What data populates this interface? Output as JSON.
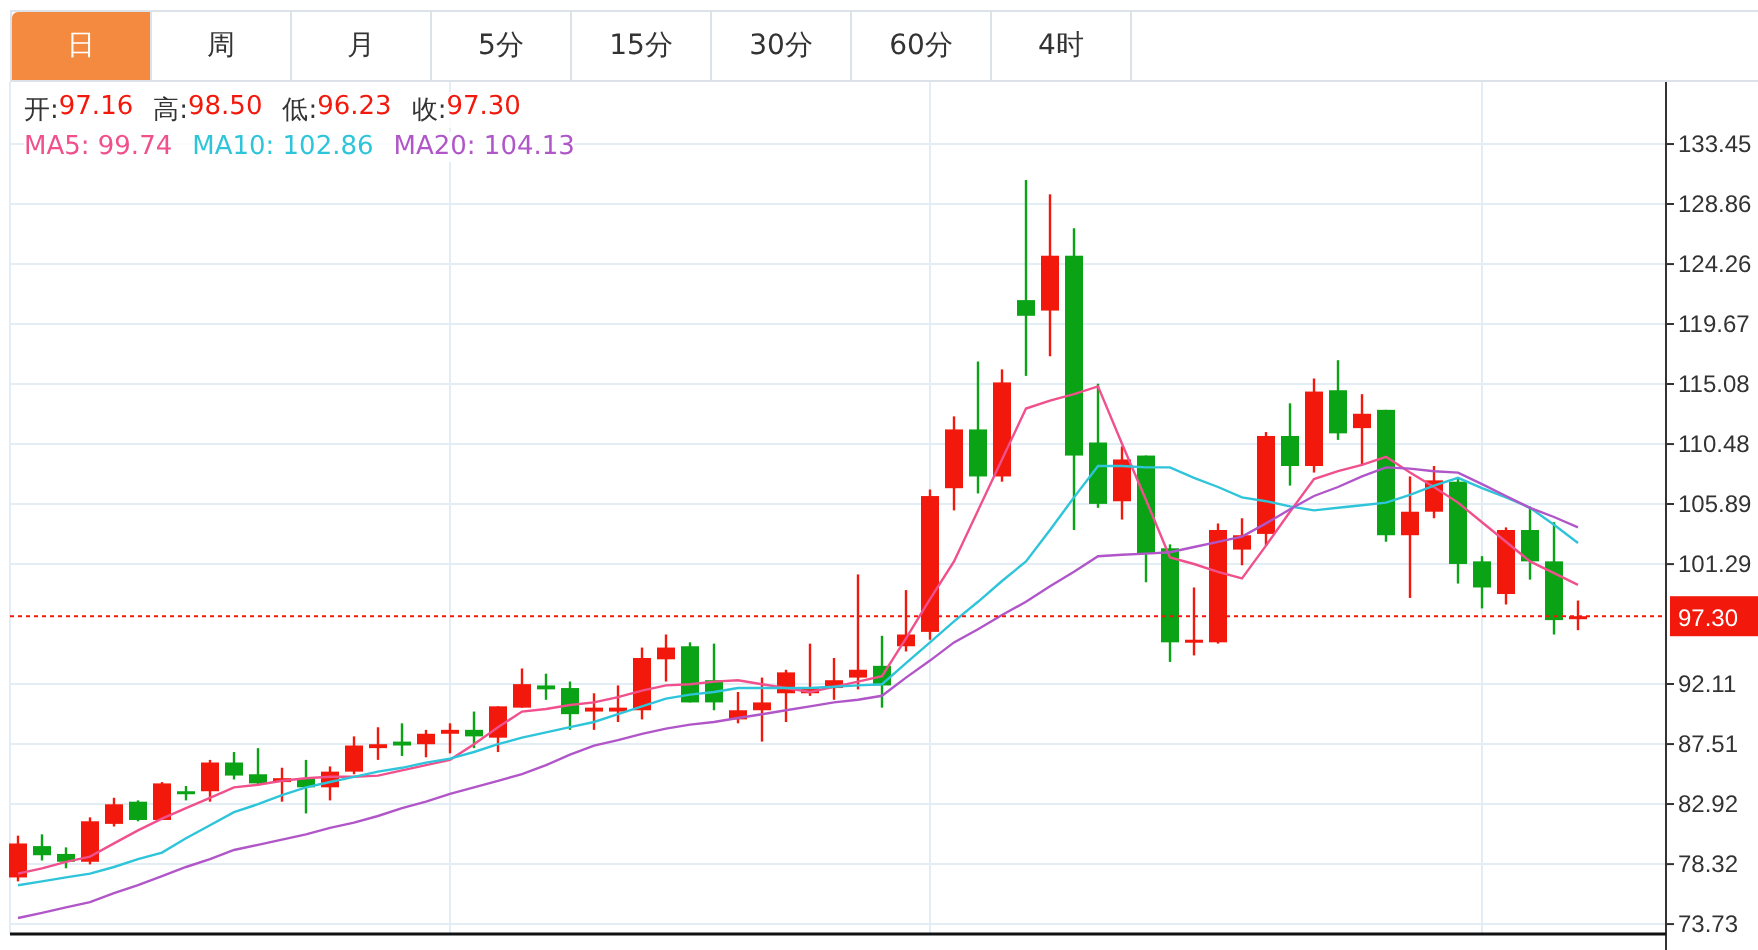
{
  "tabs": [
    {
      "label": "日",
      "selected": true
    },
    {
      "label": "周",
      "selected": false
    },
    {
      "label": "月",
      "selected": false
    },
    {
      "label": "5分",
      "selected": false
    },
    {
      "label": "15分",
      "selected": false
    },
    {
      "label": "30分",
      "selected": false
    },
    {
      "label": "60分",
      "selected": false
    },
    {
      "label": "4时",
      "selected": false
    }
  ],
  "ohlc_info": [
    {
      "label": "开:",
      "value": "97.16"
    },
    {
      "label": "高:",
      "value": "98.50"
    },
    {
      "label": "低:",
      "value": "96.23"
    },
    {
      "label": "收:",
      "value": "97.30"
    }
  ],
  "chart_data": {
    "type": "candlestick",
    "grid": true,
    "ylim": [
      72.97,
      138.2
    ],
    "yticks": [
      133.45,
      128.86,
      124.26,
      119.67,
      115.08,
      110.48,
      105.89,
      101.29,
      92.11,
      87.51,
      82.92,
      78.32,
      73.73
    ],
    "ohlc": [
      [
        77.3,
        80.5,
        77.0,
        79.9
      ],
      [
        79.7,
        80.6,
        78.6,
        79.0
      ],
      [
        79.1,
        79.6,
        78.0,
        78.5
      ],
      [
        78.5,
        81.9,
        78.3,
        81.6
      ],
      [
        81.4,
        83.4,
        81.2,
        82.9
      ],
      [
        83.1,
        83.2,
        81.6,
        81.7
      ],
      [
        81.7,
        84.6,
        81.7,
        84.5
      ],
      [
        83.9,
        84.3,
        83.2,
        83.7
      ],
      [
        83.9,
        86.3,
        83.1,
        86.1
      ],
      [
        86.1,
        86.9,
        84.8,
        85.1
      ],
      [
        85.2,
        87.2,
        84.3,
        84.5
      ],
      [
        84.6,
        85.7,
        83.1,
        84.9
      ],
      [
        84.9,
        86.3,
        82.2,
        84.2
      ],
      [
        84.2,
        85.8,
        83.2,
        85.4
      ],
      [
        85.4,
        88.1,
        85.2,
        87.4
      ],
      [
        87.2,
        88.8,
        86.3,
        87.5
      ],
      [
        87.7,
        89.1,
        86.6,
        87.4
      ],
      [
        87.5,
        88.6,
        86.5,
        88.3
      ],
      [
        88.3,
        89.1,
        86.8,
        88.6
      ],
      [
        88.6,
        90.0,
        87.2,
        88.1
      ],
      [
        88.0,
        90.4,
        86.9,
        90.4
      ],
      [
        90.3,
        93.3,
        90.3,
        92.1
      ],
      [
        92.0,
        92.9,
        90.9,
        91.7
      ],
      [
        91.8,
        92.3,
        88.6,
        89.8
      ],
      [
        90.0,
        91.4,
        88.6,
        90.3
      ],
      [
        90.0,
        92.0,
        89.2,
        90.3
      ],
      [
        90.1,
        94.9,
        89.4,
        94.1
      ],
      [
        94.0,
        95.9,
        92.3,
        94.9
      ],
      [
        95.0,
        95.3,
        90.7,
        90.7
      ],
      [
        92.4,
        95.2,
        90.1,
        90.7
      ],
      [
        89.4,
        91.5,
        89.1,
        90.1
      ],
      [
        90.1,
        92.6,
        87.7,
        90.7
      ],
      [
        91.4,
        93.2,
        89.2,
        93.0
      ],
      [
        91.4,
        95.2,
        91.2,
        91.8
      ],
      [
        91.8,
        94.1,
        90.9,
        92.4
      ],
      [
        92.6,
        100.5,
        91.7,
        93.2
      ],
      [
        93.5,
        95.8,
        90.3,
        92.0
      ],
      [
        95.0,
        99.3,
        94.6,
        95.9
      ],
      [
        96.1,
        107.0,
        95.5,
        106.5
      ],
      [
        107.1,
        112.6,
        105.4,
        111.6
      ],
      [
        111.6,
        116.8,
        106.7,
        108.0
      ],
      [
        108.0,
        116.2,
        107.6,
        115.2
      ],
      [
        121.5,
        130.7,
        115.7,
        120.3
      ],
      [
        120.7,
        129.6,
        117.2,
        124.9
      ],
      [
        124.9,
        127.0,
        103.9,
        109.6
      ],
      [
        110.6,
        115.1,
        105.6,
        105.9
      ],
      [
        106.1,
        110.3,
        104.7,
        109.3
      ],
      [
        109.6,
        109.6,
        99.9,
        102.1
      ],
      [
        102.5,
        102.8,
        93.8,
        95.3
      ],
      [
        95.3,
        99.5,
        94.3,
        95.5
      ],
      [
        95.3,
        104.4,
        95.2,
        103.9
      ],
      [
        102.4,
        104.8,
        101.2,
        103.5
      ],
      [
        103.6,
        111.4,
        102.7,
        111.1
      ],
      [
        111.1,
        113.6,
        107.3,
        108.8
      ],
      [
        108.8,
        115.5,
        108.3,
        114.5
      ],
      [
        114.6,
        116.9,
        110.8,
        111.3
      ],
      [
        111.7,
        114.3,
        108.8,
        112.8
      ],
      [
        113.1,
        113.1,
        103.0,
        103.5
      ],
      [
        103.5,
        108.0,
        98.7,
        105.3
      ],
      [
        105.3,
        108.8,
        104.8,
        107.7
      ],
      [
        107.6,
        107.9,
        99.8,
        101.3
      ],
      [
        101.5,
        101.9,
        97.9,
        99.5
      ],
      [
        99.0,
        104.1,
        98.2,
        103.9
      ],
      [
        103.9,
        105.7,
        100.1,
        101.5
      ],
      [
        101.5,
        104.5,
        95.9,
        97.0
      ],
      [
        97.16,
        98.5,
        96.23,
        97.3
      ]
    ],
    "series": [
      {
        "name": "MA5: 99.74",
        "type": "line",
        "color": "#f0508c",
        "values": [
          77.6,
          78.0,
          78.5,
          78.9,
          79.9,
          80.9,
          81.8,
          82.6,
          83.4,
          84.2,
          84.4,
          84.7,
          84.9,
          85.0,
          85.0,
          85.1,
          85.5,
          85.9,
          86.3,
          87.5,
          88.8,
          90.0,
          90.2,
          90.5,
          90.7,
          91.1,
          91.6,
          92.0,
          92.1,
          92.3,
          92.4,
          92.1,
          91.8,
          91.5,
          91.9,
          92.3,
          92.7,
          95.6,
          98.6,
          101.5,
          105.4,
          109.3,
          113.2,
          113.8,
          114.3,
          114.9,
          110.5,
          106.2,
          101.8,
          101.3,
          100.7,
          100.2,
          102.7,
          105.3,
          107.8,
          108.4,
          108.9,
          109.5,
          108.3,
          107.2,
          106.0,
          104.5,
          103.0,
          101.5,
          100.6,
          99.7
        ]
      },
      {
        "name": "MA10: 102.86",
        "type": "line",
        "color": "#2ec4da",
        "values": [
          76.7,
          77.0,
          77.3,
          77.6,
          78.1,
          78.7,
          79.2,
          80.3,
          81.3,
          82.3,
          82.9,
          83.6,
          84.2,
          84.6,
          85.0,
          85.4,
          85.7,
          86.1,
          86.4,
          86.9,
          87.5,
          88.0,
          88.4,
          88.8,
          89.2,
          89.8,
          90.4,
          91.0,
          91.3,
          91.5,
          91.8,
          91.8,
          91.8,
          91.8,
          91.9,
          92.0,
          92.1,
          93.7,
          95.3,
          96.9,
          98.4,
          100.0,
          101.5,
          103.9,
          106.4,
          108.8,
          108.8,
          108.7,
          108.7,
          107.9,
          107.2,
          106.4,
          106.1,
          105.7,
          105.4,
          105.6,
          105.8,
          106.0,
          106.6,
          107.3,
          107.9,
          107.1,
          106.4,
          105.6,
          104.3,
          102.9
        ]
      },
      {
        "name": "MA20: 104.13",
        "type": "line",
        "color": "#b056c8",
        "values": [
          74.2,
          74.6,
          75.0,
          75.4,
          76.1,
          76.7,
          77.4,
          78.1,
          78.7,
          79.4,
          79.8,
          80.2,
          80.6,
          81.1,
          81.5,
          82.0,
          82.6,
          83.1,
          83.7,
          84.2,
          84.7,
          85.2,
          85.9,
          86.7,
          87.4,
          87.8,
          88.3,
          88.7,
          89.0,
          89.2,
          89.5,
          89.8,
          90.1,
          90.4,
          90.7,
          90.9,
          91.2,
          92.6,
          93.9,
          95.3,
          96.3,
          97.4,
          98.4,
          99.6,
          100.7,
          101.9,
          102.0,
          102.1,
          102.2,
          102.6,
          103.0,
          103.4,
          104.4,
          105.5,
          106.5,
          107.2,
          108.0,
          108.7,
          108.6,
          108.4,
          108.3,
          107.4,
          106.5,
          105.6,
          104.9,
          104.1
        ]
      }
    ],
    "ref_lines": [
      {
        "axis": "y",
        "value": 97.3,
        "label": "97.30",
        "color": "#f2190c"
      }
    ]
  }
}
